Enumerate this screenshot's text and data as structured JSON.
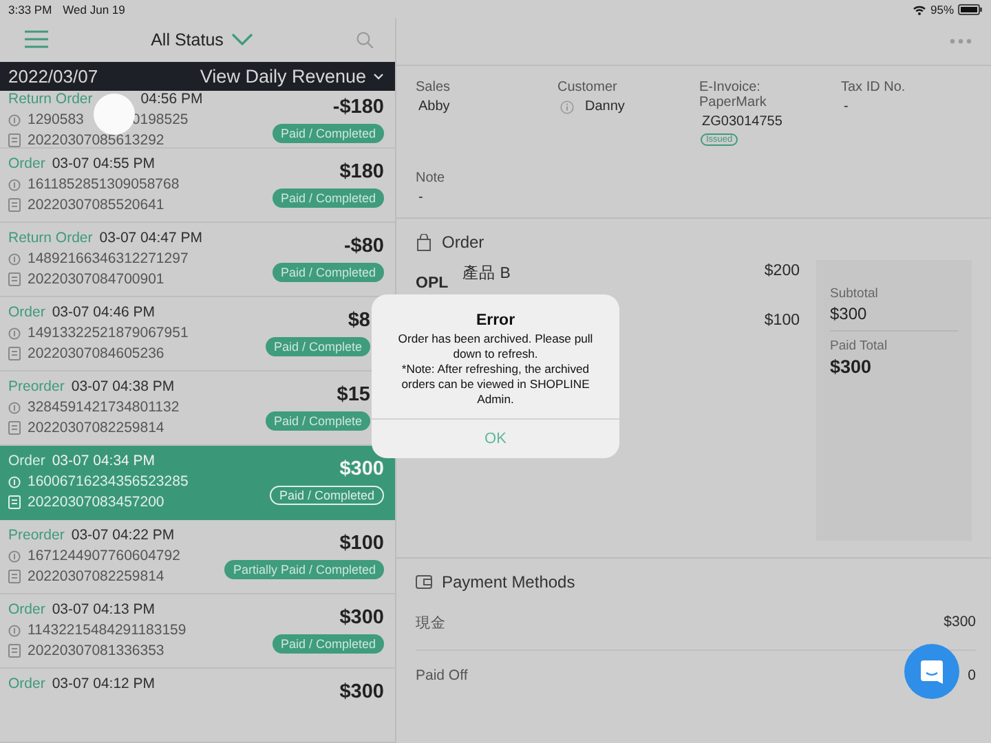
{
  "status_bar": {
    "time": "3:33 PM",
    "date": "Wed Jun 19",
    "battery": "95%"
  },
  "list_header": {
    "filter": "All Status"
  },
  "date_bar": {
    "date": "2022/03/07",
    "action": "View Daily Revenue"
  },
  "orders": [
    {
      "type": "Return Order",
      "time": "04:56 PM",
      "order_no": [
        "1290583",
        "0198525"
      ],
      "receipt_no": "20220307085613292",
      "amount": "-$180",
      "status": "Paid / Completed",
      "selected": false,
      "covered": true
    },
    {
      "type": "Order",
      "time": "03-07 04:55 PM",
      "order_no": [
        "1611852851309058768"
      ],
      "receipt_no": "20220307085520641",
      "amount": "$180",
      "status": "Paid / Completed",
      "selected": false
    },
    {
      "type": "Return Order",
      "time": "03-07 04:47 PM",
      "order_no": [
        "14892166346312271297"
      ],
      "receipt_no": "20220307084700901",
      "amount": "-$80",
      "status": "Paid / Completed",
      "selected": false
    },
    {
      "type": "Order",
      "time": "03-07 04:46 PM",
      "order_no": [
        "14913322521879067951"
      ],
      "receipt_no": "20220307084605236",
      "amount": "$8",
      "status": "Paid / Complete",
      "selected": false,
      "cut": true
    },
    {
      "type": "Preorder",
      "time": "03-07 04:38 PM",
      "order_no": [
        "3284591421734801132"
      ],
      "receipt_no": "20220307082259814",
      "amount": "$15",
      "status": "Paid / Complete",
      "selected": false,
      "cut": true
    },
    {
      "type": "Order",
      "time": "03-07 04:34 PM",
      "order_no": [
        "16006716234356523285"
      ],
      "receipt_no": "20220307083457200",
      "amount": "$300",
      "status": "Paid / Completed",
      "selected": true
    },
    {
      "type": "Preorder",
      "time": "03-07 04:22 PM",
      "order_no": [
        "1671244907760604792"
      ],
      "receipt_no": "20220307082259814",
      "amount": "$100",
      "status": "Partially Paid / Completed",
      "selected": false
    },
    {
      "type": "Order",
      "time": "03-07 04:13 PM",
      "order_no": [
        "11432215484291183159"
      ],
      "receipt_no": "20220307081336353",
      "amount": "$300",
      "status": "Paid / Completed",
      "selected": false
    },
    {
      "type": "Order",
      "time": "03-07 04:12 PM",
      "amount": "$300",
      "selected": false
    }
  ],
  "info_fields": [
    {
      "kind": "plain",
      "label": "Sales",
      "value": "Abby"
    },
    {
      "kind": "customer",
      "label": "Customer",
      "value": "Danny"
    },
    {
      "kind": "invoice",
      "label": "E-Invoice: PaperMark",
      "value": "ZG03014755",
      "badge": "Issued"
    },
    {
      "kind": "plain",
      "label": "Tax ID No.",
      "value": "-"
    },
    {
      "kind": "plain",
      "label": "Note",
      "value": "-"
    }
  ],
  "order_section": {
    "title": "Order",
    "items": [
      {
        "thumb_text": "OPL",
        "name": "產品 B",
        "price": "$200"
      },
      {
        "price": "$100"
      }
    ],
    "summary": [
      {
        "label": "Subtotal",
        "value": "$300"
      },
      {
        "label": "Paid Total",
        "value": "$300"
      }
    ]
  },
  "payment_section": {
    "title": "Payment Methods",
    "rows": [
      {
        "label": "現金",
        "value": "$300"
      },
      {
        "label": "Paid Off",
        "value": "0"
      }
    ]
  },
  "dialog": {
    "title": "Error",
    "message": [
      "Order has been archived. Please pull down to refresh.",
      "*Note: After refreshing, the archived orders can be viewed in SHOPLINE Admin."
    ],
    "button": "OK"
  }
}
